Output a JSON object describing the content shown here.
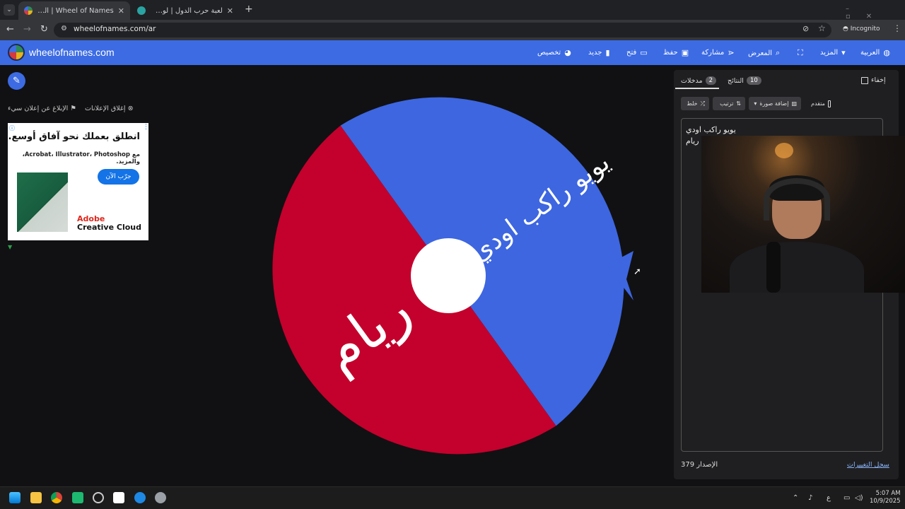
{
  "browser": {
    "tabs": [
      {
        "title": "Wheel of Names | العشوائي",
        "active": true
      },
      {
        "title": "لعبة حرب الدول | لوف ليجو يوغو",
        "active": false
      }
    ],
    "new_tab": "+",
    "url": "wheelofnames.com/ar",
    "incognito_label": "Incognito"
  },
  "site": {
    "name": "wheelofnames.com",
    "menu": {
      "customize": "تخصيص",
      "new": "جديد",
      "open": "فتح",
      "save": "حفظ",
      "share": "مشاركة",
      "gallery": "المعرض",
      "more": "المزيد",
      "language": "العربية"
    }
  },
  "left": {
    "report_ad": "الإبلاغ عن إعلان سيء",
    "close_ads": "إغلاق الإعلانات",
    "ad": {
      "headline": "انطلق بعملك نحو آفاق أوسع.",
      "sub": "مع Acrobat، Illustrator، Photoshop، والمزيد.",
      "cta": "جرّب الآن",
      "brand_line1": "Adobe",
      "brand_line2": "Creative Cloud"
    }
  },
  "wheel": {
    "segments": [
      {
        "label": "يويو راكب اودي",
        "color": "#3d66e0"
      },
      {
        "label": "ريام",
        "color": "#c4002c"
      }
    ],
    "center_color": "#ffffff",
    "pointer_color": "#3d66e0"
  },
  "panel": {
    "hide_label": "إخفاء",
    "results_tab": "النتائج",
    "results_count": "10",
    "entries_tab": "مدخلات",
    "entries_count": "2",
    "shuffle": "خلط",
    "sort": "ترتيب",
    "add_image": "إضافة صورة",
    "advanced": "متقدم",
    "entries": [
      "يويو راكب اودي",
      "ريام"
    ],
    "version_label": "الإصدار",
    "version_number": "379",
    "changelog": "سجل التغييرات"
  },
  "taskbar": {
    "time": "5:07 AM",
    "date": "10/9/2025",
    "lang": "ع"
  }
}
